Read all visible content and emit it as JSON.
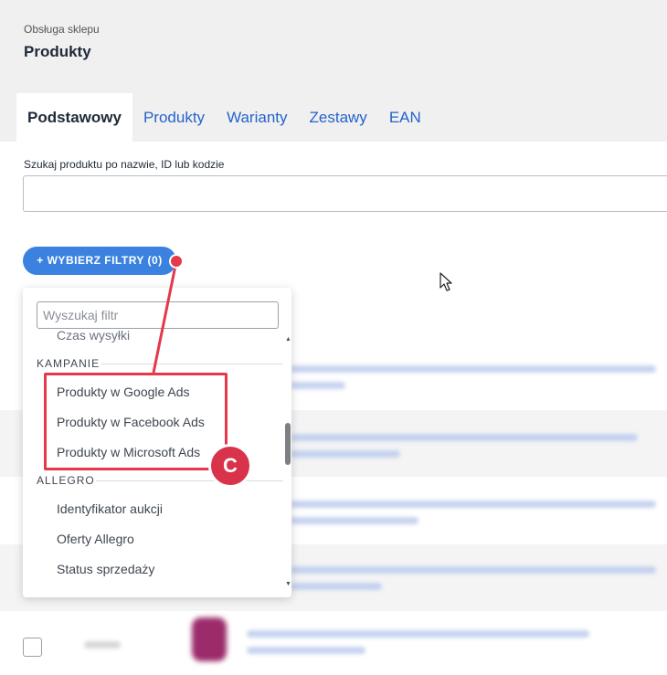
{
  "header": {
    "breadcrumb": "Obsługa sklepu",
    "title": "Produkty"
  },
  "tabs": [
    {
      "label": "Podstawowy",
      "active": true
    },
    {
      "label": "Produkty",
      "active": false
    },
    {
      "label": "Warianty",
      "active": false
    },
    {
      "label": "Zestawy",
      "active": false
    },
    {
      "label": "EAN",
      "active": false
    }
  ],
  "search": {
    "label": "Szukaj produktu po nazwie, ID lub kodzie",
    "value": "",
    "placeholder": ""
  },
  "filters_button": {
    "label": "+ WYBIERZ FILTRY (0)"
  },
  "dropdown": {
    "search_placeholder": "Wyszukaj filtr",
    "cut_item": "Czas wysyłki",
    "groups": [
      {
        "title": "KAMPANIE",
        "items": [
          "Produkty w Google Ads",
          "Produkty w Facebook Ads",
          "Produkty w Microsoft Ads"
        ]
      },
      {
        "title": "ALLEGRO",
        "items": [
          "Identyfikator aukcji",
          "Oferty Allegro",
          "Status sprzedaży"
        ]
      }
    ]
  },
  "annotation": {
    "badge_label": "C",
    "color": "#e5384a"
  },
  "colors": {
    "accent": "#3b82e0",
    "link": "#2563c9",
    "badge": "#d9324b"
  }
}
